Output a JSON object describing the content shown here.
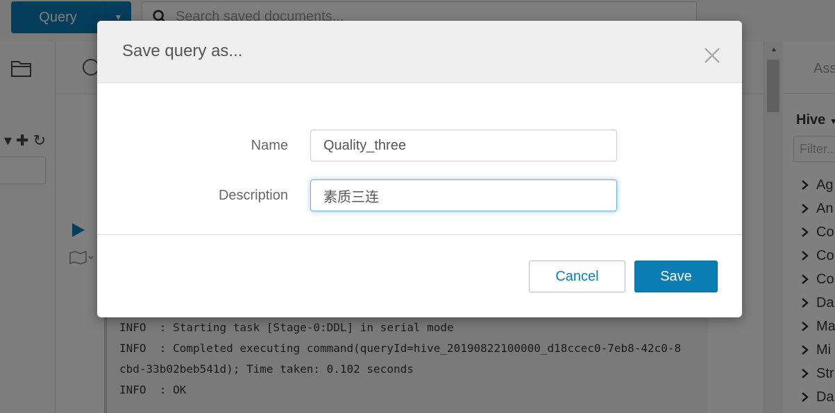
{
  "topbar": {
    "query_label": "Query",
    "search_placeholder": "Search saved documents..."
  },
  "log": {
    "lines": [
      "INFO  : Starting task [Stage-0:DDL] in serial mode",
      "INFO  : Completed executing command(queryId=hive_20190822100000_d18ccec0-7eb8-42c0-8",
      "cbd-33b02beb541d); Time taken: 0.102 seconds",
      "INFO  : OK"
    ]
  },
  "right_panel": {
    "tab_label": "Assist",
    "source_label": "Hive",
    "filter_placeholder": "Filter...",
    "databases": [
      "Ag",
      "An",
      "Co",
      "Co",
      "Co",
      "Da",
      "Ma",
      "Mi",
      "Str",
      "Da"
    ]
  },
  "modal": {
    "title": "Save query as...",
    "name_label": "Name",
    "name_value": "Quality_three",
    "description_label": "Description",
    "description_value": "素质三连",
    "cancel_label": "Cancel",
    "save_label": "Save"
  },
  "colors": {
    "accent": "#0b7db5",
    "focus": "#66afe9",
    "overlay": "rgba(0,0,0,0.5)"
  }
}
